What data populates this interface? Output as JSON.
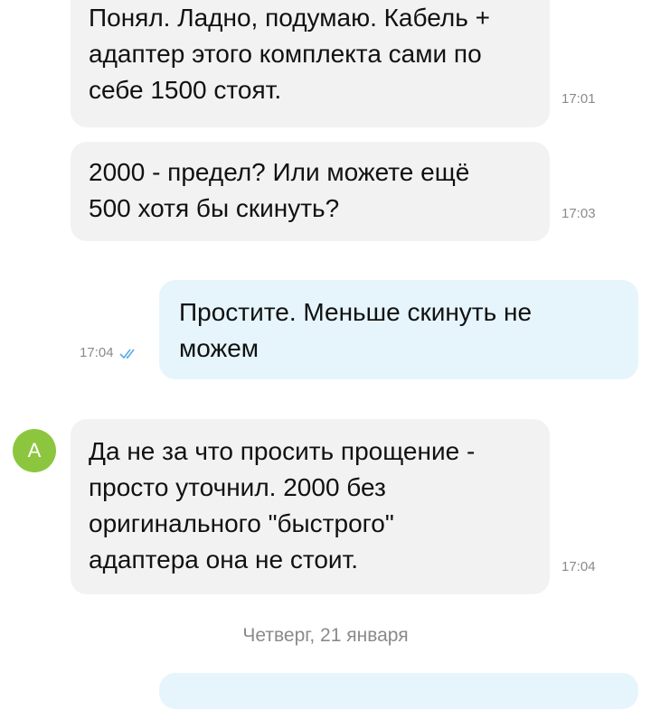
{
  "messages": [
    {
      "direction": "incoming",
      "text": "Понял. Ладно, подумаю. Кабель +\nадаптер этого комплекта сами по\nсебе 1500 стоят.",
      "time": "17:01"
    },
    {
      "direction": "incoming",
      "text": "2000 - предел? Или можете ещё\n500 хотя бы скинуть?",
      "time": "17:03"
    },
    {
      "direction": "outgoing",
      "text": "Простите. Меньше скинуть не\nможем",
      "time": "17:04",
      "status": "read"
    },
    {
      "direction": "incoming",
      "avatar_letter": "A",
      "text": "Да не за что просить прощение -\nпросто уточнил. 2000 без\nоригинального \"быстрого\"\nадаптера она не стоит.",
      "time": "17:04"
    }
  ],
  "date_separator": "Четверг, 21 января",
  "colors": {
    "incoming_bubble": "#f2f2f2",
    "outgoing_bubble": "#e6f5fc",
    "avatar": "#8cc63f",
    "read_check": "#5aa9e6"
  }
}
